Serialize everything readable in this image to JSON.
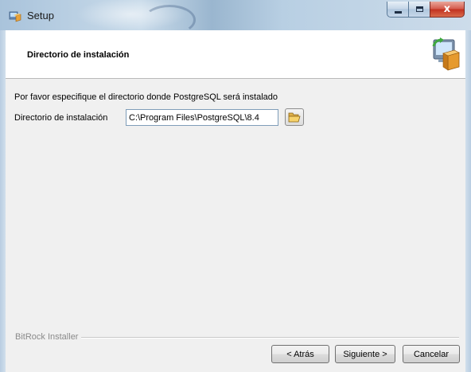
{
  "window": {
    "title": "Setup",
    "caption_close": "x"
  },
  "header": {
    "title": "Directorio de instalación"
  },
  "content": {
    "instruction": "Por favor especifique el directorio donde PostgreSQL será instalado",
    "dir_label": "Directorio de instalación",
    "dir_value": "C:\\Program Files\\PostgreSQL\\8.4"
  },
  "footer": {
    "installer_label": "BitRock Installer",
    "back_label": "< Atrás",
    "next_label": "Siguiente >",
    "cancel_label": "Cancelar"
  },
  "icons": {
    "app": "setup-icon",
    "header": "computer-install-icon",
    "browse": "folder-open-icon"
  },
  "colors": {
    "titlebar": "#b8cfe3",
    "close_button": "#c1301f",
    "header_bg": "#ffffff",
    "body_bg": "#f0f0f0"
  }
}
